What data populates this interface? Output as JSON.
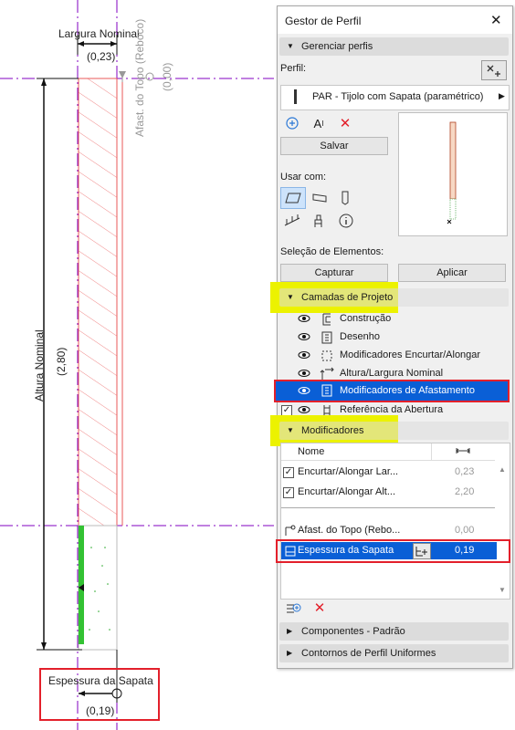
{
  "drawing": {
    "width_label": "Largura Nominal",
    "width_value": "(0,23)",
    "height_label": "Altura Nominal",
    "height_value": "(2,80)",
    "offset_label": "Afast. do Topo (Reboco)",
    "offset_value": "(0,00)",
    "footing_label": "Espessura da Sapata",
    "footing_value": "(0,19)"
  },
  "panel": {
    "title": "Gestor de Perfil",
    "manage_section": "Gerenciar perfis",
    "profile_label": "Perfil:",
    "profile_value": "PAR - Tijolo com Sapata (paramétrico)",
    "save_button": "Salvar",
    "use_with_label": "Usar com:",
    "element_selection_label": "Seleção de Elementos:",
    "capture_button": "Capturar",
    "apply_button": "Aplicar",
    "layers_section": "Camadas de Projeto",
    "layers": [
      {
        "label": "Construção",
        "icon": "construction-layer-icon",
        "checked": false
      },
      {
        "label": "Desenho",
        "icon": "drawing-layer-icon",
        "checked": false
      },
      {
        "label": "Modificadores Encurtar/Alongar",
        "icon": "stretch-modifiers-icon",
        "checked": false
      },
      {
        "label": "Altura/Largura Nominal",
        "icon": "nominal-size-icon",
        "checked": false
      },
      {
        "label": "Modificadores de Afastamento",
        "icon": "offset-modifiers-icon",
        "checked": false,
        "selected": true
      },
      {
        "label": "Referência da Abertura",
        "icon": "opening-reference-icon",
        "checked": true
      }
    ],
    "modifiers_section": "Modificadores",
    "modifiers_header_name": "Nome",
    "modifiers": [
      {
        "name": "Encurtar/Alongar Lar...",
        "value": "0,23",
        "checked": true
      },
      {
        "name": "Encurtar/Alongar Alt...",
        "value": "2,20",
        "checked": true
      },
      {
        "name": "Afast. do Topo (Rebo...",
        "value": "0,00",
        "checked": false
      },
      {
        "name": "Espessura da Sapata",
        "value": "0,19",
        "checked": false,
        "selected": true
      }
    ],
    "components_section": "Componentes - Padrão",
    "contours_section": "Contornos de Perfil Uniformes"
  },
  "colors": {
    "selection_blue": "#0a5fd6",
    "highlight_red": "#e3202b",
    "highlight_yellow": "#ecf200",
    "guide_purple": "#7b00c8"
  }
}
